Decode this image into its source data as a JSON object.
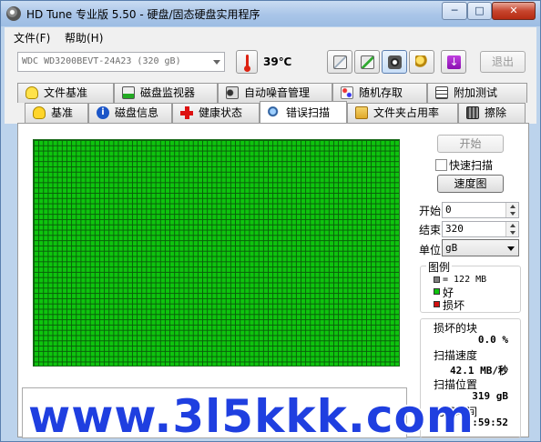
{
  "window": {
    "title": "HD Tune 专业版 5.50 - 硬盘/固态硬盘实用程序",
    "minimize": "─",
    "maximize": "□",
    "close": "✕"
  },
  "menu": {
    "file": "文件(F)",
    "help": "帮助(H)"
  },
  "toolbar": {
    "drive": "WDC WD3200BEVT-24A23 (320 gB)",
    "temperature": "39℃",
    "exit": "退出",
    "icons": [
      "copy-info-icon",
      "copy-screen-icon",
      "screenshot-camera-icon",
      "options-wrench-icon",
      "save-download-icon"
    ]
  },
  "tabs": {
    "row1": [
      "文件基准",
      "磁盘监视器",
      "自动噪音管理",
      "随机存取",
      "附加测试"
    ],
    "row2": [
      "基准",
      "磁盘信息",
      "健康状态",
      "错误扫描",
      "文件夹占用率",
      "擦除"
    ],
    "active": "错误扫描"
  },
  "scan": {
    "start_button": "开始",
    "quick_scan_label": "快速扫描",
    "quick_scan_checked": false,
    "map_button": "速度图",
    "start_label": "开始",
    "start_value": "0",
    "end_label": "结束",
    "end_value": "320",
    "unit_label": "单位",
    "unit_value": "gB",
    "legend_title": "图例",
    "legend_block": "= 122 MB",
    "legend_good": "好",
    "legend_bad": "损坏",
    "bad_blocks_label": "损坏的块",
    "bad_blocks_value": "0.0 %",
    "scan_speed_label": "扫描速度",
    "scan_speed_value": "42.1 MB/秒",
    "scan_position_label": "扫描位置",
    "scan_position_value": "319 gB",
    "elapsed_label": "已用时间",
    "elapsed_value": "1:59:52",
    "colors": {
      "good": "#0ec40e",
      "bad": "#d21010",
      "block": "#808080"
    }
  },
  "watermark": "www.3l5kkk.com"
}
